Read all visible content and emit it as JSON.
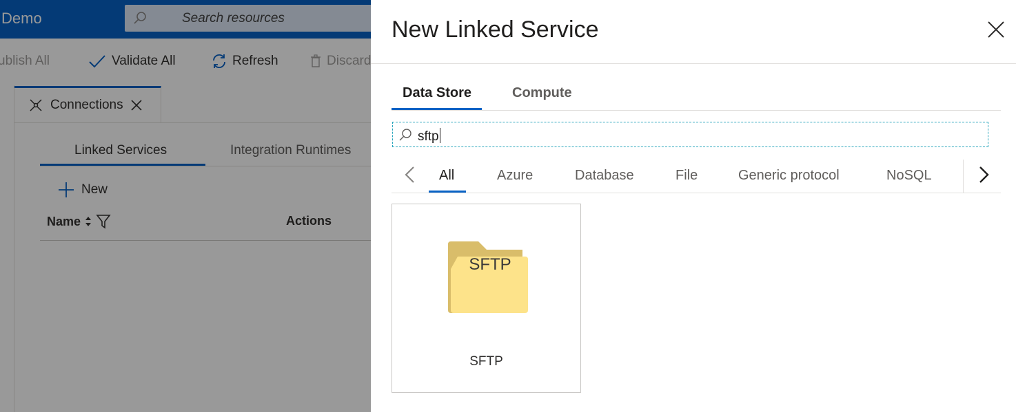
{
  "app": {
    "title": "Demo",
    "search_placeholder": "Search resources"
  },
  "toolbar": {
    "publish_all": "ublish All",
    "validate_all": "Validate All",
    "refresh": "Refresh",
    "discard": "Discard"
  },
  "connections_tab": {
    "label": "Connections"
  },
  "subtabs": {
    "linked_services": "Linked Services",
    "integration_runtimes": "Integration Runtimes"
  },
  "list": {
    "new_label": "New",
    "col_name": "Name",
    "col_actions": "Actions"
  },
  "panel": {
    "title": "New Linked Service",
    "tabs": [
      "Data Store",
      "Compute"
    ],
    "search_value": "sftp",
    "categories": [
      "All",
      "Azure",
      "Database",
      "File",
      "Generic protocol",
      "NoSQL"
    ],
    "results": [
      {
        "icon_text": "SFTP",
        "label": "SFTP",
        "icon": "folder-icon"
      }
    ]
  },
  "colors": {
    "topbar": "#0862c5",
    "accent": "#0862c5",
    "folder_front": "#fde38a",
    "folder_back": "#d9bd6a",
    "filter_border": "#2aa6bd"
  }
}
